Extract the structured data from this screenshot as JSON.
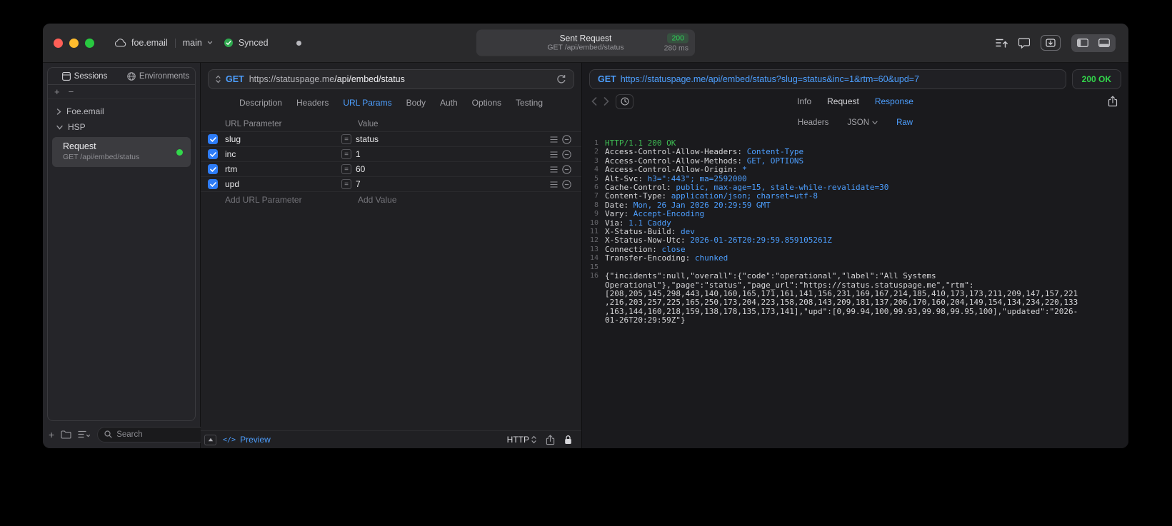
{
  "glyphs": {
    "plus": "+",
    "minus": "−",
    "equals": "=",
    "code": "</>"
  },
  "titlebar": {
    "project": "foe.email",
    "branch": "main",
    "sync_status": "Synced",
    "pill": {
      "title": "Sent Request",
      "status_code": "200",
      "request_line": "GET /api/embed/status",
      "duration": "280 ms"
    }
  },
  "sidebar": {
    "tabs": [
      {
        "label": "Sessions"
      },
      {
        "label": "Environments"
      }
    ],
    "tree": [
      {
        "label": "Foe.email"
      },
      {
        "label": "HSP"
      }
    ],
    "request_item": {
      "title": "Request",
      "subtitle": "GET /api/embed/status"
    },
    "search_placeholder": "Search"
  },
  "request_panel": {
    "method": "GET",
    "url_host": "https://statuspage.me",
    "url_path": "/api/embed/status",
    "tabs": [
      "Description",
      "Headers",
      "URL Params",
      "Body",
      "Auth",
      "Options",
      "Testing"
    ],
    "active_tab": "URL Params",
    "table": {
      "columns": [
        "URL Parameter",
        "Value"
      ],
      "rows": [
        {
          "name": "slug",
          "value": "status",
          "checked": true
        },
        {
          "name": "inc",
          "value": "1",
          "checked": true
        },
        {
          "name": "rtm",
          "value": "60",
          "checked": true
        },
        {
          "name": "upd",
          "value": "7",
          "checked": true
        }
      ],
      "add_name_placeholder": "Add URL Parameter",
      "add_value_placeholder": "Add Value"
    },
    "footer": {
      "preview_label": "Preview",
      "protocol": "HTTP"
    }
  },
  "response_panel": {
    "method": "GET",
    "url": "https://statuspage.me/api/embed/status?slug=status&inc=1&rtm=60&upd=7",
    "status": "200 OK",
    "tabs": [
      "Info",
      "Request",
      "Response"
    ],
    "active_tab": "Response",
    "subtabs": [
      "Headers",
      "JSON",
      "Raw"
    ],
    "active_subtab": "Raw",
    "code": {
      "lines": [
        {
          "num": 1,
          "parts": [
            {
              "t": "HTTP/1.1 200 OK",
              "c": "g"
            }
          ]
        },
        {
          "num": 2,
          "parts": [
            {
              "t": "Access-Control-Allow-Headers: ",
              "c": "k"
            },
            {
              "t": "Content-Type",
              "c": "b"
            }
          ]
        },
        {
          "num": 3,
          "parts": [
            {
              "t": "Access-Control-Allow-Methods: ",
              "c": "k"
            },
            {
              "t": "GET, OPTIONS",
              "c": "b"
            }
          ]
        },
        {
          "num": 4,
          "parts": [
            {
              "t": "Access-Control-Allow-Origin: ",
              "c": "k"
            },
            {
              "t": "*",
              "c": "b"
            }
          ]
        },
        {
          "num": 5,
          "parts": [
            {
              "t": "Alt-Svc: ",
              "c": "k"
            },
            {
              "t": "h3=\":443\"; ma=2592000",
              "c": "b"
            }
          ]
        },
        {
          "num": 6,
          "parts": [
            {
              "t": "Cache-Control: ",
              "c": "k"
            },
            {
              "t": "public, max-age=15, stale-while-revalidate=30",
              "c": "b"
            }
          ]
        },
        {
          "num": 7,
          "parts": [
            {
              "t": "Content-Type: ",
              "c": "k"
            },
            {
              "t": "application/json; charset=utf-8",
              "c": "b"
            }
          ]
        },
        {
          "num": 8,
          "parts": [
            {
              "t": "Date: ",
              "c": "k"
            },
            {
              "t": "Mon, 26 Jan 2026 20:29:59 GMT",
              "c": "b"
            }
          ]
        },
        {
          "num": 9,
          "parts": [
            {
              "t": "Vary: ",
              "c": "k"
            },
            {
              "t": "Accept-Encoding",
              "c": "b"
            }
          ]
        },
        {
          "num": 10,
          "parts": [
            {
              "t": "Via: ",
              "c": "k"
            },
            {
              "t": "1.1 Caddy",
              "c": "b"
            }
          ]
        },
        {
          "num": 11,
          "parts": [
            {
              "t": "X-Status-Build: ",
              "c": "k"
            },
            {
              "t": "dev",
              "c": "b"
            }
          ]
        },
        {
          "num": 12,
          "parts": [
            {
              "t": "X-Status-Now-Utc: ",
              "c": "k"
            },
            {
              "t": "2026-01-26T20:29:59.859105261Z",
              "c": "b"
            }
          ]
        },
        {
          "num": 13,
          "parts": [
            {
              "t": "Connection: ",
              "c": "k"
            },
            {
              "t": "close",
              "c": "b"
            }
          ]
        },
        {
          "num": 14,
          "parts": [
            {
              "t": "Transfer-Encoding: ",
              "c": "k"
            },
            {
              "t": "chunked",
              "c": "b"
            }
          ]
        },
        {
          "num": 15,
          "parts": []
        },
        {
          "num": 16,
          "parts": [
            {
              "t": "{\"incidents\":null,\"overall\":{\"code\":\"operational\",\"label\":\"All Systems Operational\"},\"page\":\"status\",\"page_url\":\"https://status.statuspage.me\",\"rtm\":[208,205,145,298,443,140,160,165,171,161,141,156,231,169,167,214,185,410,173,173,211,209,147,157,221,216,203,257,225,165,250,173,204,223,158,208,143,209,181,137,206,170,160,204,149,154,134,234,220,133,163,144,160,218,159,138,178,135,173,141],\"upd\":[0,99.94,100,99.93,99.98,99.95,100],\"updated\":\"2026-01-26T20:29:59Z\"}",
              "c": "k"
            }
          ]
        }
      ]
    }
  }
}
